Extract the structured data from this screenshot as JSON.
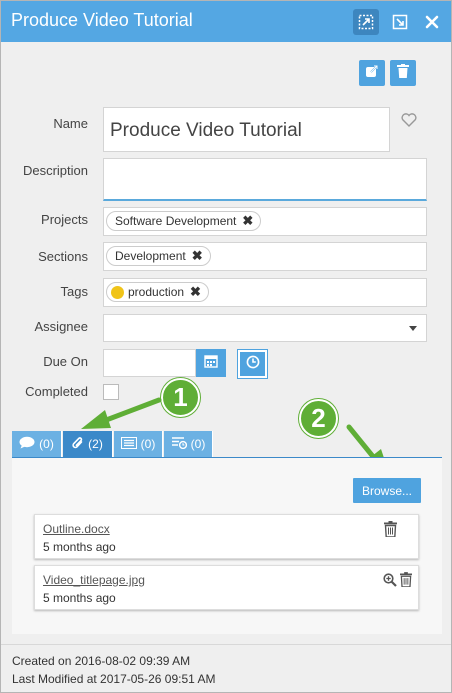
{
  "window": {
    "title": "Produce Video Tutorial"
  },
  "icons": {
    "titlebar": [
      "expand-icon",
      "popout-icon",
      "close-icon"
    ],
    "actions": [
      "open-external-icon",
      "trash-icon"
    ]
  },
  "form": {
    "name_label": "Name",
    "name_value": "Produce Video Tutorial",
    "description_label": "Description",
    "description_value": "",
    "projects_label": "Projects",
    "projects": [
      "Software Development"
    ],
    "sections_label": "Sections",
    "sections": [
      "Development"
    ],
    "tags_label": "Tags",
    "tags": [
      {
        "label": "production",
        "color": "#f0c419"
      }
    ],
    "assignee_label": "Assignee",
    "assignee_value": "",
    "due_label": "Due On",
    "due_value": "",
    "completed_label": "Completed",
    "completed": false
  },
  "annotations": {
    "callout_1": "1",
    "callout_2": "2",
    "arrow_color": "#5fae36"
  },
  "tabs": [
    {
      "icon": "comment-icon",
      "count": "(0)"
    },
    {
      "icon": "paperclip-icon",
      "count": "(2)",
      "active": true
    },
    {
      "icon": "list-icon",
      "count": "(0)"
    },
    {
      "icon": "checklist-icon",
      "count": "(0)"
    }
  ],
  "attachments": {
    "browse_label": "Browse...",
    "files": [
      {
        "name": "Outline.docx",
        "age": "5 months ago"
      },
      {
        "name": "Video_titlepage.jpg",
        "age": "5 months ago"
      }
    ]
  },
  "footer": {
    "created": "Created on 2016-08-02 09:39 AM",
    "modified": "Last Modified at 2017-05-26 09:51 AM"
  },
  "colors": {
    "accent": "#54a7e3",
    "accent_dark": "#3b89c9",
    "badge_green": "#5fae36"
  }
}
